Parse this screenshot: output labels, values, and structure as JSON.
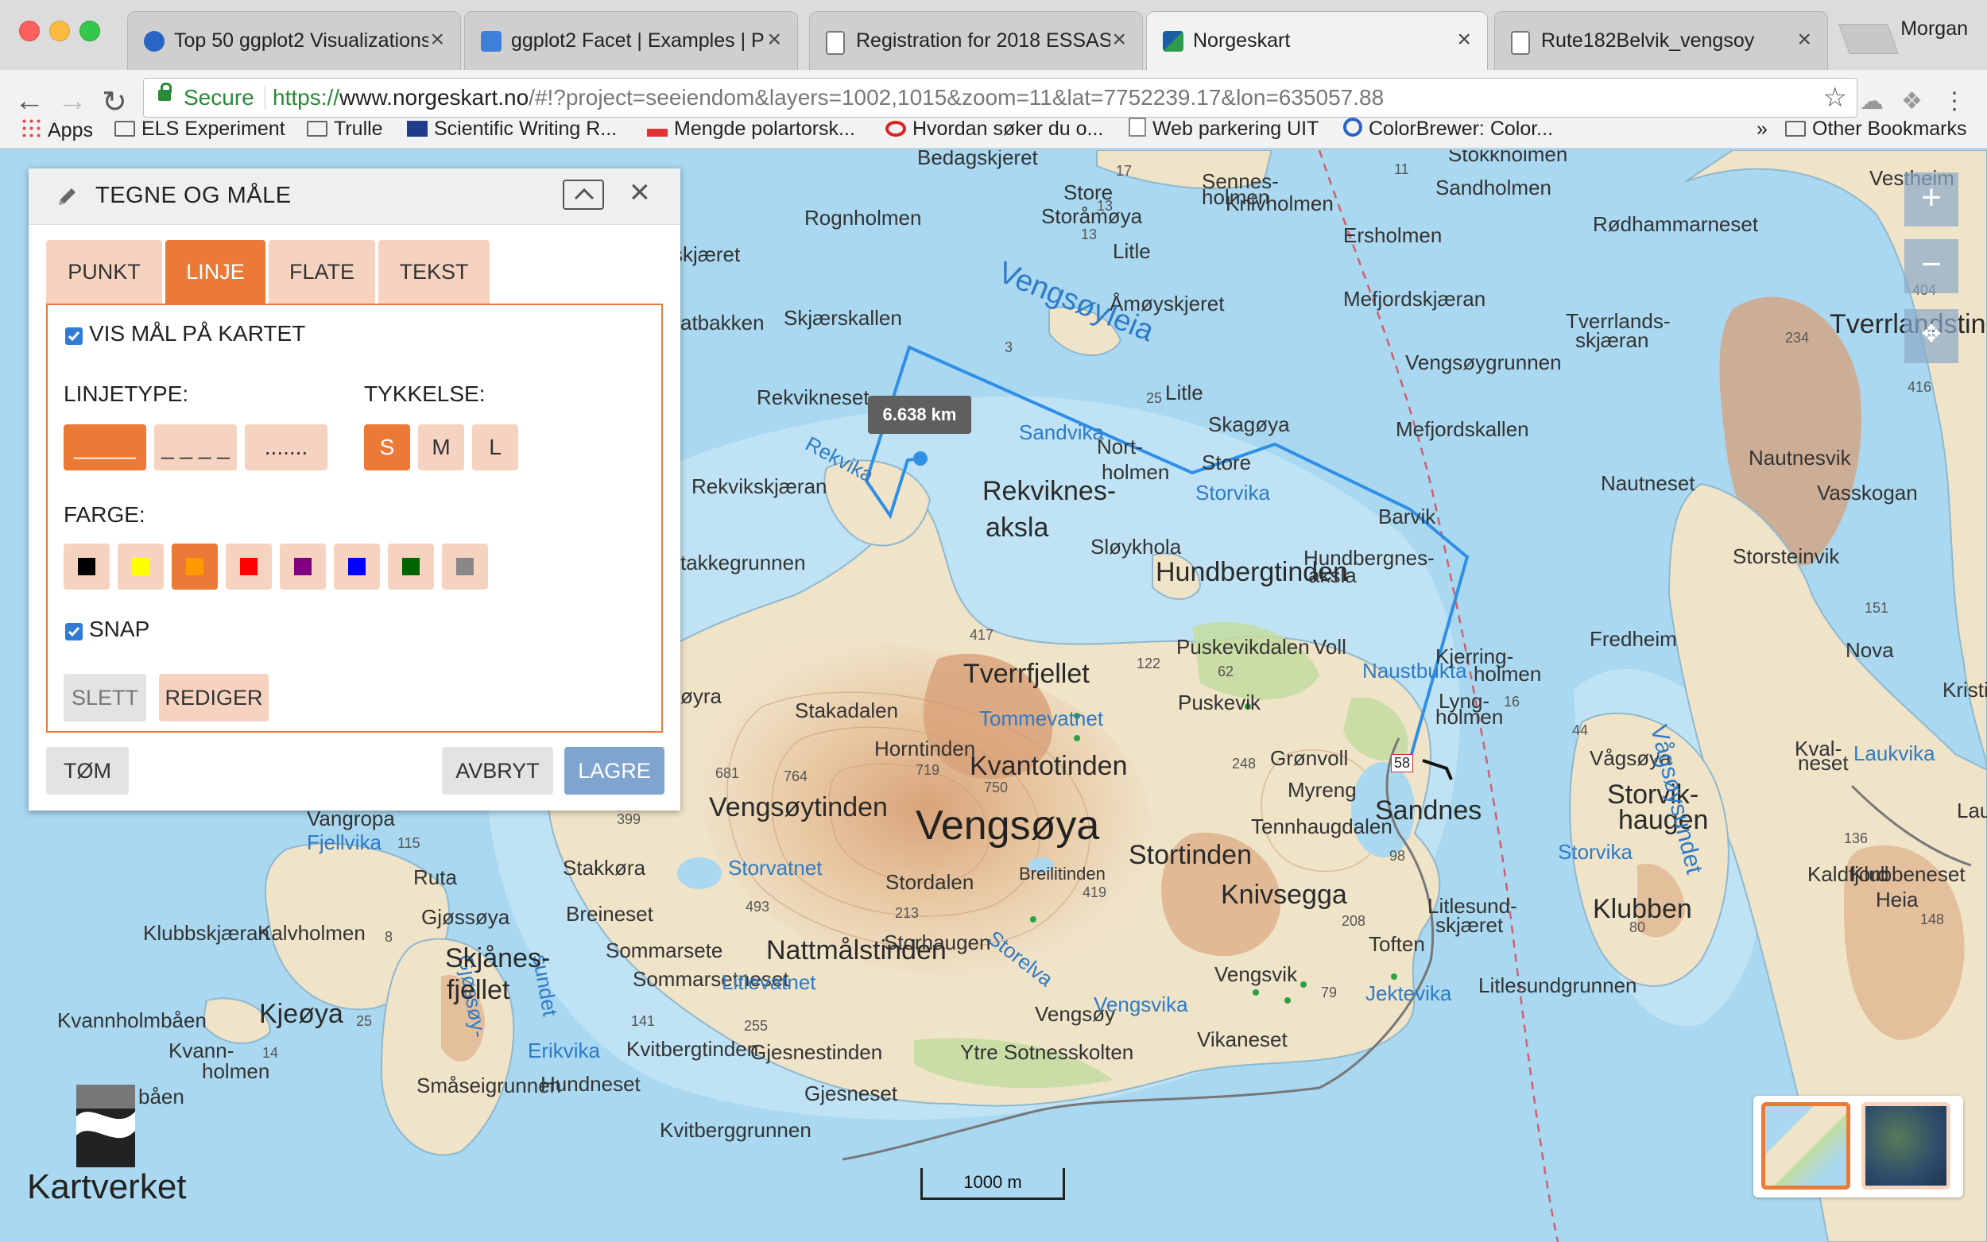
{
  "browser": {
    "tabs": [
      {
        "title": "Top 50 ggplot2 Visualizations",
        "icon": "r-logo-icon"
      },
      {
        "title": "ggplot2 Facet | Examples | Pl",
        "icon": "plotly-icon"
      },
      {
        "title": "Registration for 2018 ESSAS",
        "icon": "document-icon"
      },
      {
        "title": "Norgeskart",
        "icon": "norgeskart-icon"
      },
      {
        "title": "Rute182Belvik_vengsoy",
        "icon": "document-icon"
      }
    ],
    "active_tab": 3,
    "profile": "Morgan",
    "secure_label": "Secure",
    "url_scheme": "https://",
    "url_host": "www.norgeskart.no",
    "url_path": "/#!?project=seeiendom&layers=1002,1015&zoom=11&lat=7752239.17&lon=635057.88",
    "bookmarks": [
      {
        "label": "Apps",
        "icon": "apps-grid-icon"
      },
      {
        "label": "ELS Experiment",
        "icon": "folder-icon"
      },
      {
        "label": "Trulle",
        "icon": "folder-icon"
      },
      {
        "label": "Scientific Writing R...",
        "icon": "uit-icon"
      },
      {
        "label": "Mengde polartorsk...",
        "icon": "nosi-icon"
      },
      {
        "label": "Hvordan søker du o...",
        "icon": "red-oval-icon"
      },
      {
        "label": "Web parkering UIT",
        "icon": "page-icon"
      },
      {
        "label": "ColorBrewer: Color...",
        "icon": "colorbrewer-icon"
      }
    ],
    "other_bookmarks": "Other Bookmarks",
    "more": "»"
  },
  "panel": {
    "title": "TEGNE OG MÅLE",
    "tabs": [
      "PUNKT",
      "LINJE",
      "FLATE",
      "TEKST"
    ],
    "active_tab": "LINJE",
    "show_measure": "VIS MÅL PÅ KARTET",
    "show_measure_checked": true,
    "line_type_label": "LINJETYPE:",
    "line_types": [
      "_____",
      "_ _ _ _",
      "......."
    ],
    "selected_line_type": 0,
    "thickness_label": "TYKKELSE:",
    "thickness": [
      "S",
      "M",
      "L"
    ],
    "selected_thickness": "S",
    "color_label": "FARGE:",
    "colors": [
      "#000000",
      "#ffff00",
      "#ff9900",
      "#ff0000",
      "#800080",
      "#0000ff",
      "#006400",
      "#888888"
    ],
    "selected_color": 2,
    "snap": "SNAP",
    "snap_checked": true,
    "delete": "SLETT",
    "edit": "REDIGER",
    "clear": "TØM",
    "cancel": "AVBRYT",
    "save": "LAGRE"
  },
  "map": {
    "measure_tooltip": "6.638 km",
    "scale": "1000 m",
    "logo": "Kartverket",
    "zoom_in": "+",
    "zoom_out": "−",
    "colors": {
      "sea": "#a9d8f0",
      "land": "#f0e6cf",
      "route": "#2f8fe6",
      "accent": "#ea7a35"
    },
    "labels": [
      {
        "text": "Vengsøya",
        "cls": "big"
      },
      {
        "text": "Tverrfjellet",
        "cls": "med"
      },
      {
        "text": "Hundbergtinden",
        "cls": "med"
      },
      {
        "text": "Kvantotinden",
        "cls": "med"
      },
      {
        "text": "Vengsøytinden",
        "cls": "med"
      },
      {
        "text": "Nattmålstinden",
        "cls": "med"
      },
      {
        "text": "Horntinden",
        "cls": ""
      },
      {
        "text": "Stortinden",
        "cls": ""
      },
      {
        "text": "Knivsegga",
        "cls": ""
      },
      {
        "text": "Sandnes",
        "cls": "med"
      },
      {
        "text": "Rekviknes-",
        "cls": ""
      },
      {
        "text": "aksla",
        "cls": ""
      },
      {
        "text": "Sløykhola",
        "cls": ""
      },
      {
        "text": "Skagøya",
        "cls": ""
      },
      {
        "text": "Rekvikneset",
        "cls": ""
      },
      {
        "text": "Rekvikskjæran",
        "cls": ""
      },
      {
        "text": "Skjærskallen",
        "cls": ""
      },
      {
        "text": "Rognholmen",
        "cls": ""
      },
      {
        "text": "Åmøyskjeret",
        "cls": ""
      },
      {
        "text": "Store",
        "cls": ""
      },
      {
        "text": "Storåmøya",
        "cls": ""
      },
      {
        "text": "Litle",
        "cls": ""
      },
      {
        "text": "Bedagskjeret",
        "cls": ""
      },
      {
        "text": "Sennes-",
        "cls": ""
      },
      {
        "text": "holmen",
        "cls": ""
      },
      {
        "text": "Knivholmen",
        "cls": ""
      },
      {
        "text": "Ersholmen",
        "cls": ""
      },
      {
        "text": "Sandholmen",
        "cls": ""
      },
      {
        "text": "Stokkholmen",
        "cls": ""
      },
      {
        "text": "Rødhammarneset",
        "cls": ""
      },
      {
        "text": "Mefjordskjæran",
        "cls": ""
      },
      {
        "text": "Vengsøygrunnen",
        "cls": ""
      },
      {
        "text": "Mefjordskallen",
        "cls": ""
      },
      {
        "text": "Tverrlands-",
        "cls": ""
      },
      {
        "text": "skjæran",
        "cls": ""
      },
      {
        "text": "Nautneset",
        "cls": ""
      },
      {
        "text": "Nautnesvik",
        "cls": ""
      },
      {
        "text": "Vasskogan",
        "cls": ""
      },
      {
        "text": "Storsteinvik",
        "cls": ""
      },
      {
        "text": "Fredheim",
        "cls": ""
      },
      {
        "text": "Nova",
        "cls": ""
      },
      {
        "text": "Kristian",
        "cls": ""
      },
      {
        "text": "Kval-",
        "cls": ""
      },
      {
        "text": "neset",
        "cls": ""
      },
      {
        "text": "Laukvika",
        "cls": "water"
      },
      {
        "text": "Lauk",
        "cls": ""
      },
      {
        "text": "Vågsøya",
        "cls": ""
      },
      {
        "text": "Storvik-",
        "cls": ""
      },
      {
        "text": "haugen",
        "cls": ""
      },
      {
        "text": "Storvika",
        "cls": "water"
      },
      {
        "text": "Kaldfjord",
        "cls": ""
      },
      {
        "text": "Klubbeneset",
        "cls": ""
      },
      {
        "text": "Heia",
        "cls": ""
      },
      {
        "text": "Klubben",
        "cls": ""
      },
      {
        "text": "Litlesund-",
        "cls": ""
      },
      {
        "text": "skjæret",
        "cls": ""
      },
      {
        "text": "Litlesundgrunnen",
        "cls": ""
      },
      {
        "text": "Toften",
        "cls": ""
      },
      {
        "text": "Jektevika",
        "cls": "water"
      },
      {
        "text": "Vengsvik",
        "cls": ""
      },
      {
        "text": "Vengsøy",
        "cls": ""
      },
      {
        "text": "Vengsvika",
        "cls": "water"
      },
      {
        "text": "Vikaneset",
        "cls": ""
      },
      {
        "text": "Ytre Sotnesskolten",
        "cls": ""
      },
      {
        "text": "Gjesneset",
        "cls": ""
      },
      {
        "text": "Kvitberggrunnen",
        "cls": ""
      },
      {
        "text": "Gjesnestinden",
        "cls": ""
      },
      {
        "text": "Kvitbergtinden",
        "cls": ""
      },
      {
        "text": "Småseigrunnen",
        "cls": ""
      },
      {
        "text": "Hundneset",
        "cls": ""
      },
      {
        "text": "Sommarsetneset",
        "cls": ""
      },
      {
        "text": "Litlevatnet",
        "cls": "water"
      },
      {
        "text": "Sommarsete",
        "cls": ""
      },
      {
        "text": "Storhaugen",
        "cls": ""
      },
      {
        "text": "Storelva",
        "cls": "water"
      },
      {
        "text": "Breilitinden",
        "cls": ""
      },
      {
        "text": "Stordalen",
        "cls": ""
      },
      {
        "text": "Storvatnet",
        "cls": "water"
      },
      {
        "text": "Stakkøra",
        "cls": ""
      },
      {
        "text": "Breineset",
        "cls": ""
      },
      {
        "text": "Tommevatnet",
        "cls": "water"
      },
      {
        "text": "Stakadalen",
        "cls": ""
      },
      {
        "text": "Puskevikdalen",
        "cls": ""
      },
      {
        "text": "Puskevik",
        "cls": ""
      },
      {
        "text": "Voll",
        "cls": ""
      },
      {
        "text": "Naustbukta",
        "cls": "water"
      },
      {
        "text": "Kjerring-",
        "cls": ""
      },
      {
        "text": "holmen",
        "cls": ""
      },
      {
        "text": "Lyng-",
        "cls": ""
      },
      {
        "text": "holmen",
        "cls": ""
      },
      {
        "text": "Hundbergnes-",
        "cls": ""
      },
      {
        "text": "aksla",
        "cls": ""
      },
      {
        "text": "Barvik",
        "cls": ""
      },
      {
        "text": "Grønvoll",
        "cls": ""
      },
      {
        "text": "Myreng",
        "cls": ""
      },
      {
        "text": "Tennhaugdalen",
        "cls": ""
      },
      {
        "text": "Storvika",
        "cls": "water"
      },
      {
        "text": "Sandvika",
        "cls": "water"
      },
      {
        "text": "Nort-",
        "cls": ""
      },
      {
        "text": "holmen",
        "cls": ""
      },
      {
        "text": "Store",
        "cls": ""
      },
      {
        "text": "Litle",
        "cls": ""
      },
      {
        "text": "Vengsøyleia",
        "cls": "water"
      },
      {
        "text": "Rekvika",
        "cls": "water"
      },
      {
        "text": "Vangropa",
        "cls": ""
      },
      {
        "text": "Fjellvika",
        "cls": "water"
      },
      {
        "text": "Ruta",
        "cls": ""
      },
      {
        "text": "Gjøssøya",
        "cls": ""
      },
      {
        "text": "Gjøssøy-",
        "cls": "water"
      },
      {
        "text": "sundet",
        "cls": "water"
      },
      {
        "text": "Skjånes-",
        "cls": ""
      },
      {
        "text": "fjellet",
        "cls": ""
      },
      {
        "text": "Klubbskjæran",
        "cls": ""
      },
      {
        "text": "Kalvholmen",
        "cls": ""
      },
      {
        "text": "Kjeøya",
        "cls": ""
      },
      {
        "text": "Kvannholmbåen",
        "cls": ""
      },
      {
        "text": "Kvann-",
        "cls": ""
      },
      {
        "text": "holmen",
        "cls": ""
      },
      {
        "text": "Erikvika",
        "cls": "water"
      },
      {
        "text": "Vågsøysundet",
        "cls": "water"
      },
      {
        "text": "Tverrlandstind",
        "cls": ""
      },
      {
        "text": "Vestheim",
        "cls": ""
      },
      {
        "text": "skjæret",
        "cls": ""
      },
      {
        "text": "atbakken",
        "cls": ""
      },
      {
        "text": "takkegrunnen",
        "cls": ""
      },
      {
        "text": "øyra",
        "cls": ""
      },
      {
        "text": "båen",
        "cls": ""
      }
    ],
    "heights": [
      "17",
      "13",
      "13",
      "11",
      "3",
      "25",
      "417",
      "122",
      "62",
      "681",
      "764",
      "719",
      "750",
      "248",
      "16",
      "44",
      "399",
      "493",
      "213",
      "419",
      "98",
      "208",
      "79",
      "141",
      "255",
      "115",
      "8",
      "25",
      "14",
      "234",
      "404",
      "416",
      "151",
      "136",
      "148",
      "80"
    ],
    "route_marker": "58"
  }
}
